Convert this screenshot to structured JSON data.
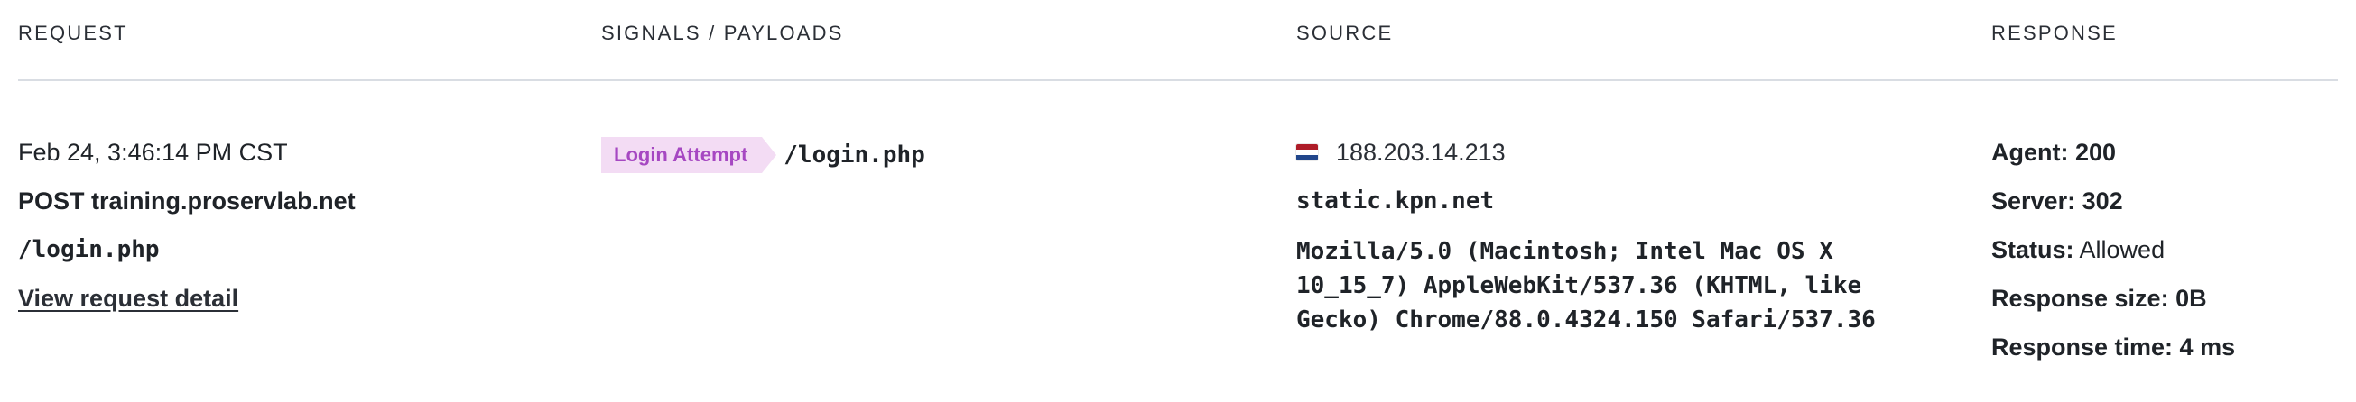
{
  "headers": {
    "request": "REQUEST",
    "signals": "SIGNALS / PAYLOADS",
    "source": "SOURCE",
    "response": "RESPONSE"
  },
  "request": {
    "timestamp": "Feb 24, 3:46:14 PM CST",
    "method_host": "POST training.proservlab.net",
    "path": "/login.php",
    "detail_link": "View request detail"
  },
  "signals": {
    "tag": "Login Attempt",
    "tag_color": "#a648c2",
    "tag_bg": "#f3dcf4",
    "path": "/login.php"
  },
  "source": {
    "flag_icon": "netherlands-flag-icon",
    "flag_colors": [
      "#ae1c28",
      "#ffffff",
      "#21468b"
    ],
    "ip": "188.203.14.213",
    "host": "static.kpn.net",
    "user_agent": "Mozilla/5.0 (Macintosh; Intel Mac OS X 10_15_7) AppleWebKit/537.36 (KHTML, like Gecko) Chrome/88.0.4324.150 Safari/537.36"
  },
  "response": {
    "agent": "Agent: 200",
    "server": "Server: 302",
    "status_label": "Status:",
    "status_value": "Allowed",
    "size": "Response size: 0B",
    "time": "Response time: 4 ms"
  }
}
